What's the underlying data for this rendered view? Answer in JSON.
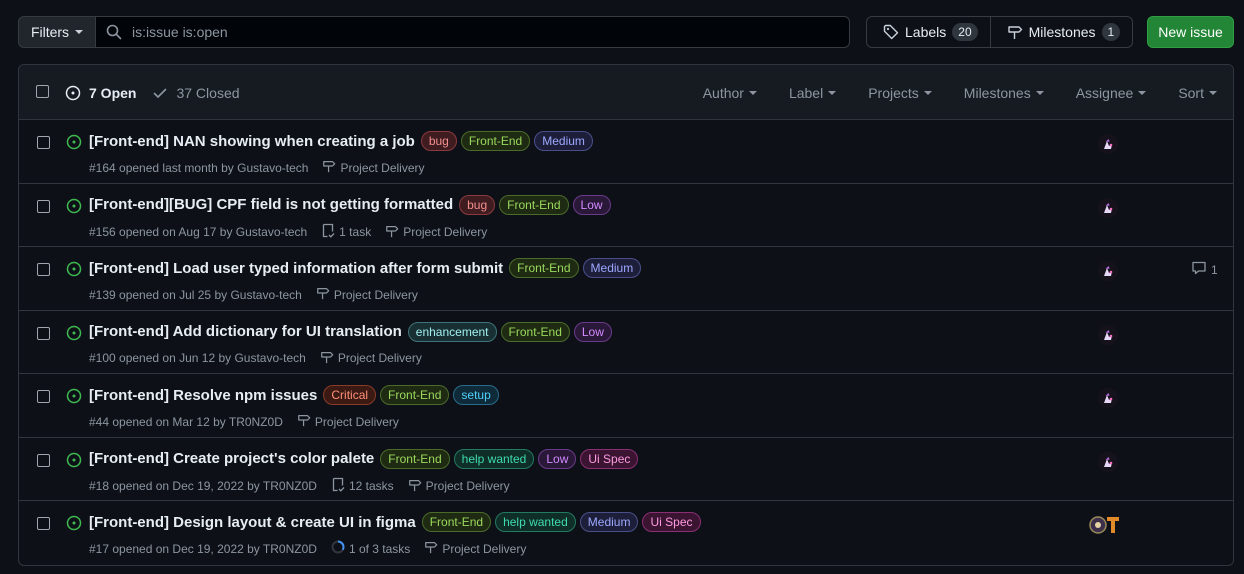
{
  "toolbar": {
    "filters_label": "Filters",
    "search_value": "is:issue is:open",
    "labels_label": "Labels",
    "labels_count": "20",
    "milestones_label": "Milestones",
    "milestones_count": "1",
    "new_issue_label": "New issue"
  },
  "header": {
    "open_label": "7 Open",
    "closed_label": "37 Closed",
    "filters": [
      "Author",
      "Label",
      "Projects",
      "Milestones",
      "Assignee",
      "Sort"
    ]
  },
  "label_colors": {
    "bug": {
      "fg": "#f58f8f",
      "bg": "#3e1c1f",
      "border": "#8b3a3f"
    },
    "Front-End": {
      "fg": "#9ad95c",
      "bg": "#1f2a13",
      "border": "#4a6b2a"
    },
    "Medium": {
      "fg": "#9da8ff",
      "bg": "#1d1f3a",
      "border": "#4a4f8a"
    },
    "Low": {
      "fg": "#d28bff",
      "bg": "#2a1838",
      "border": "#6a3a8a"
    },
    "enhancement": {
      "fg": "#a2eeef",
      "bg": "#183033",
      "border": "#3f7377"
    },
    "Critical": {
      "fg": "#ff9078",
      "bg": "#3a1a12",
      "border": "#8a3a28"
    },
    "setup": {
      "fg": "#4fd2ff",
      "bg": "#0f2a38",
      "border": "#2a6a8a"
    },
    "help wanted": {
      "fg": "#3fdbb0",
      "bg": "#0f2e27",
      "border": "#237a63"
    },
    "Ui Spec": {
      "fg": "#ff9be2",
      "bg": "#3a1431",
      "border": "#8a2f73"
    }
  },
  "issues": [
    {
      "title": "[Front-end] NAN showing when creating a job",
      "labels": [
        "bug",
        "Front-End",
        "Medium"
      ],
      "meta": "#164 opened last month by Gustavo-tech",
      "tasks": "",
      "milestone": "Project Delivery",
      "comments": ""
    },
    {
      "title": "[Front-end][BUG] CPF field is not getting formatted",
      "labels": [
        "bug",
        "Front-End",
        "Low"
      ],
      "meta": "#156 opened on Aug 17 by Gustavo-tech",
      "tasks": "1 task",
      "milestone": "Project Delivery",
      "comments": ""
    },
    {
      "title": "[Front-end] Load user typed information after form submit",
      "labels": [
        "Front-End",
        "Medium"
      ],
      "meta": "#139 opened on Jul 25 by Gustavo-tech",
      "tasks": "",
      "milestone": "Project Delivery",
      "comments": "1"
    },
    {
      "title": "[Front-end] Add dictionary for UI translation",
      "labels": [
        "enhancement",
        "Front-End",
        "Low"
      ],
      "meta": "#100 opened on Jun 12 by Gustavo-tech",
      "tasks": "",
      "milestone": "Project Delivery",
      "comments": ""
    },
    {
      "title": "[Front-end] Resolve npm issues",
      "labels": [
        "Critical",
        "Front-End",
        "setup"
      ],
      "meta": "#44 opened on Mar 12 by TR0NZ0D",
      "tasks": "",
      "milestone": "Project Delivery",
      "comments": ""
    },
    {
      "title": "[Front-end] Create project's color palete",
      "labels": [
        "Front-End",
        "help wanted",
        "Low",
        "Ui Spec"
      ],
      "meta": "#18 opened on Dec 19, 2022 by TR0NZ0D",
      "tasks": "12 tasks",
      "milestone": "Project Delivery",
      "comments": ""
    },
    {
      "title": "[Front-end] Design layout & create UI in figma",
      "labels": [
        "Front-End",
        "help wanted",
        "Medium",
        "Ui Spec"
      ],
      "meta": "#17 opened on Dec 19, 2022 by TR0NZ0D",
      "tasks": "1 of 3 tasks",
      "milestone": "Project Delivery",
      "comments": "",
      "progress": 0.33
    }
  ]
}
